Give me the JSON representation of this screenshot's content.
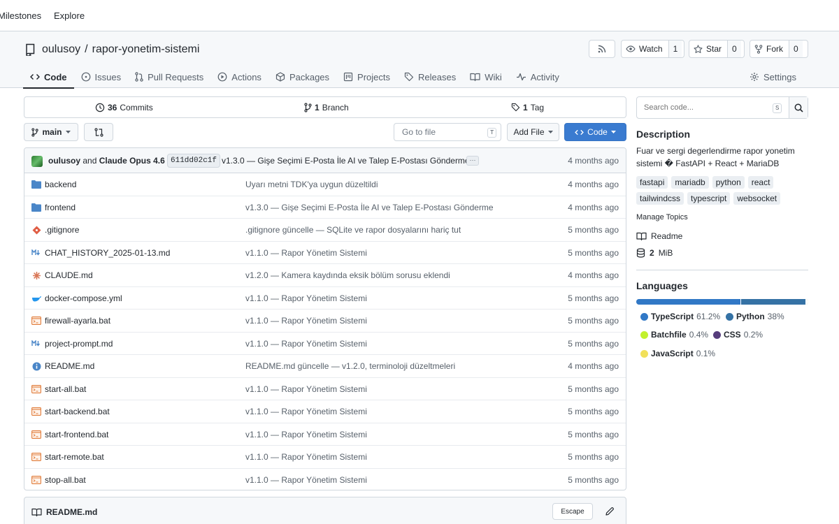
{
  "topnav": {
    "milestones": "Milestones",
    "explore": "Explore"
  },
  "repo": {
    "owner": "oulusoy",
    "separator": "/",
    "name": "rapor-yonetim-sistemi"
  },
  "actions": {
    "watch_label": "Watch",
    "watch_count": "1",
    "star_label": "Star",
    "star_count": "0",
    "fork_label": "Fork",
    "fork_count": "0"
  },
  "tabs": [
    {
      "label": "Code",
      "icon": "code-icon"
    },
    {
      "label": "Issues",
      "icon": "issue-icon"
    },
    {
      "label": "Pull Requests",
      "icon": "pull-request-icon"
    },
    {
      "label": "Actions",
      "icon": "play-icon"
    },
    {
      "label": "Packages",
      "icon": "package-icon"
    },
    {
      "label": "Projects",
      "icon": "project-icon"
    },
    {
      "label": "Releases",
      "icon": "tag-icon"
    },
    {
      "label": "Wiki",
      "icon": "book-icon"
    },
    {
      "label": "Activity",
      "icon": "pulse-icon"
    }
  ],
  "settings_label": "Settings",
  "stats": {
    "commits_count": "36",
    "commits_label": "Commits",
    "branch_count": "1",
    "branch_label": "Branch",
    "tag_count": "1",
    "tag_label": "Tag"
  },
  "toolbar": {
    "branch": "main",
    "goto_placeholder": "Go to file",
    "goto_key": "T",
    "add_file": "Add File",
    "code": "Code"
  },
  "last_commit": {
    "author1": "oulusoy",
    "and": "and",
    "author2": "Claude Opus 4.6",
    "sha": "611dd02c1f",
    "message": "v1.3.0 — Gişe Seçimi E-Posta İle AI ve Talep E-Postası Gönderme",
    "ellipsis": "···",
    "time": "4 months ago"
  },
  "files": [
    {
      "name": "backend",
      "icon": "folder-icon",
      "message": "Uyarı metni TDK'ya uygun düzeltildi",
      "time": "4 months ago"
    },
    {
      "name": "frontend",
      "icon": "folder-icon",
      "message": "v1.3.0 — Gişe Seçimi E-Posta İle AI ve Talep E-Postası Gönderme",
      "time": "4 months ago"
    },
    {
      "name": ".gitignore",
      "icon": "git-icon",
      "message": ".gitignore güncelle — SQLite ve rapor dosyalarını hariç tut",
      "time": "5 months ago"
    },
    {
      "name": "CHAT_HISTORY_2025-01-13.md",
      "icon": "markdown-icon",
      "message": "v1.1.0 — Rapor Yönetim Sistemi",
      "time": "5 months ago"
    },
    {
      "name": "CLAUDE.md",
      "icon": "claude-icon",
      "message": "v1.2.0 — Kamera kaydında eksik bölüm sorusu eklendi",
      "time": "4 months ago"
    },
    {
      "name": "docker-compose.yml",
      "icon": "docker-icon",
      "message": "v1.1.0 — Rapor Yönetim Sistemi",
      "time": "5 months ago"
    },
    {
      "name": "firewall-ayarla.bat",
      "icon": "terminal-icon",
      "message": "v1.1.0 — Rapor Yönetim Sistemi",
      "time": "5 months ago"
    },
    {
      "name": "project-prompt.md",
      "icon": "markdown-icon",
      "message": "v1.1.0 — Rapor Yönetim Sistemi",
      "time": "5 months ago"
    },
    {
      "name": "README.md",
      "icon": "info-icon",
      "message": "README.md güncelle — v1.2.0, terminoloji düzeltmeleri",
      "time": "4 months ago"
    },
    {
      "name": "start-all.bat",
      "icon": "terminal-icon",
      "message": "v1.1.0 — Rapor Yönetim Sistemi",
      "time": "5 months ago"
    },
    {
      "name": "start-backend.bat",
      "icon": "terminal-icon",
      "message": "v1.1.0 — Rapor Yönetim Sistemi",
      "time": "5 months ago"
    },
    {
      "name": "start-frontend.bat",
      "icon": "terminal-icon",
      "message": "v1.1.0 — Rapor Yönetim Sistemi",
      "time": "5 months ago"
    },
    {
      "name": "start-remote.bat",
      "icon": "terminal-icon",
      "message": "v1.1.0 — Rapor Yönetim Sistemi",
      "time": "5 months ago"
    },
    {
      "name": "stop-all.bat",
      "icon": "terminal-icon",
      "message": "v1.1.0 — Rapor Yönetim Sistemi",
      "time": "5 months ago"
    }
  ],
  "readme": {
    "title": "README.md",
    "escape": "Escape"
  },
  "sidebar": {
    "search_placeholder": "Search code...",
    "search_key": "S",
    "description_heading": "Description",
    "description": "Fuar ve sergi degerlendirme rapor yonetim sistemi � FastAPI + React + MariaDB",
    "topics": [
      "fastapi",
      "mariadb",
      "python",
      "react",
      "tailwindcss",
      "typescript",
      "websocket"
    ],
    "manage_topics": "Manage Topics",
    "readme_label": "Readme",
    "size_value": "2",
    "size_unit": "MiB",
    "languages_heading": "Languages",
    "languages": [
      {
        "name": "TypeScript",
        "percent": "61.2%",
        "value": 61.2,
        "color": "#3178c6"
      },
      {
        "name": "Python",
        "percent": "38%",
        "value": 38.0,
        "color": "#3572A5"
      },
      {
        "name": "Batchfile",
        "percent": "0.4%",
        "value": 0.4,
        "color": "#C1F12E"
      },
      {
        "name": "CSS",
        "percent": "0.2%",
        "value": 0.2,
        "color": "#563d7c"
      },
      {
        "name": "JavaScript",
        "percent": "0.1%",
        "value": 0.1,
        "color": "#f1e05a"
      }
    ]
  }
}
